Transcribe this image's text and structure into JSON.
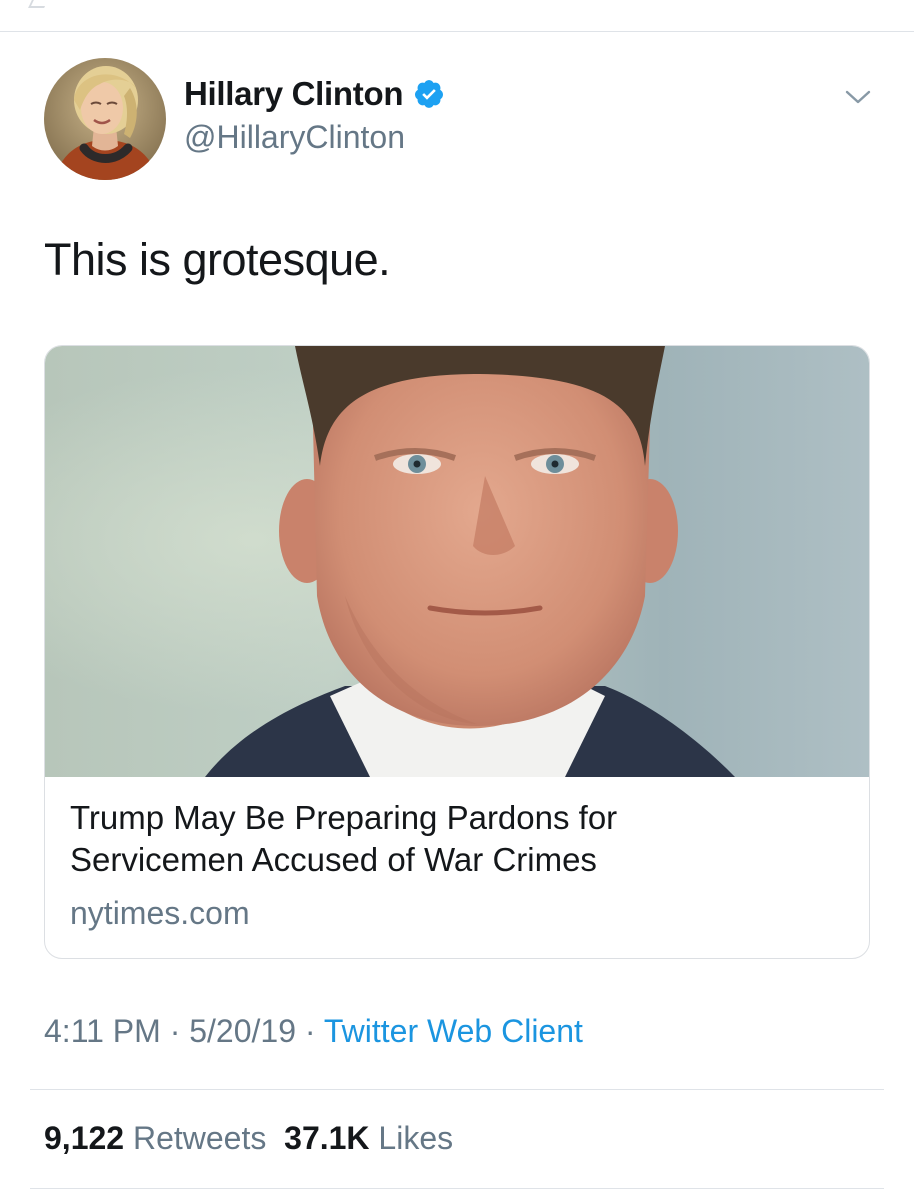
{
  "author": {
    "display_name": "Hillary Clinton",
    "handle": "@HillaryClinton",
    "verified_icon": "verified-badge-icon",
    "menu_icon": "chevron-down-icon"
  },
  "tweet": {
    "text": "This is grotesque."
  },
  "card": {
    "title_line1": "Trump May Be Preparing Pardons for",
    "title_line2": "Servicemen Accused of War Crimes",
    "domain": "nytimes.com"
  },
  "meta": {
    "time": "4:11 PM",
    "separator1": " · ",
    "date": "5/20/19",
    "separator2": " · ",
    "source": "Twitter Web Client"
  },
  "stats": {
    "retweets_count": "9,122",
    "retweets_label": "Retweets",
    "likes_count": "37.1K",
    "likes_label": "Likes"
  },
  "colors": {
    "link_blue": "#1b95e0",
    "secondary_gray": "#657786",
    "verified_blue": "#1da1f2"
  }
}
